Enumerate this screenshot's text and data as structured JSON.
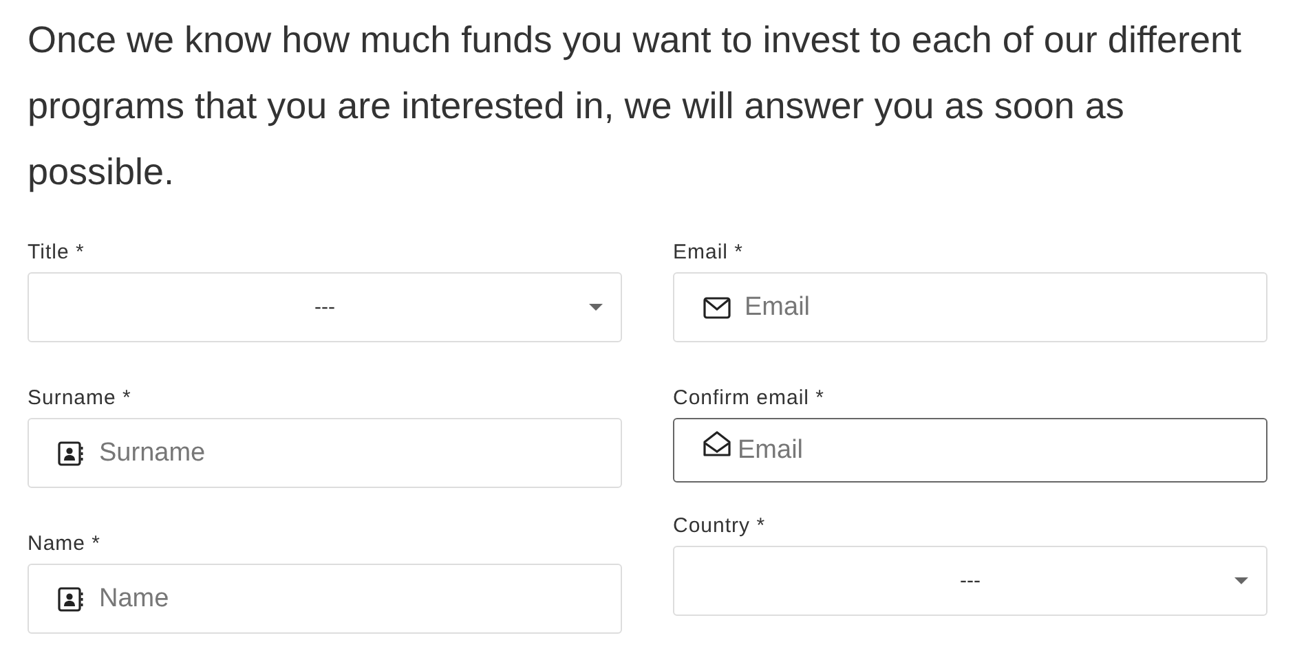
{
  "intro": "Once we know how much funds you want to invest to each of our different programs that you are interested in, we will answer you as soon as possible.",
  "columns": [
    {
      "fields": [
        {
          "label": "Title *",
          "kind": "select",
          "value": "---",
          "focused": false
        },
        {
          "label": "Surname *",
          "kind": "contact",
          "placeholder": "Surname",
          "focused": false
        },
        {
          "label": "Name *",
          "kind": "contact",
          "placeholder": "Name",
          "focused": false
        }
      ]
    },
    {
      "fields": [
        {
          "label": "Email *",
          "kind": "email",
          "placeholder": "Email",
          "focused": false
        },
        {
          "label": "Confirm email *",
          "kind": "email-open",
          "placeholder": "Email",
          "focused": true
        },
        {
          "label": "Country *",
          "kind": "select",
          "value": "---",
          "focused": false
        }
      ]
    }
  ]
}
